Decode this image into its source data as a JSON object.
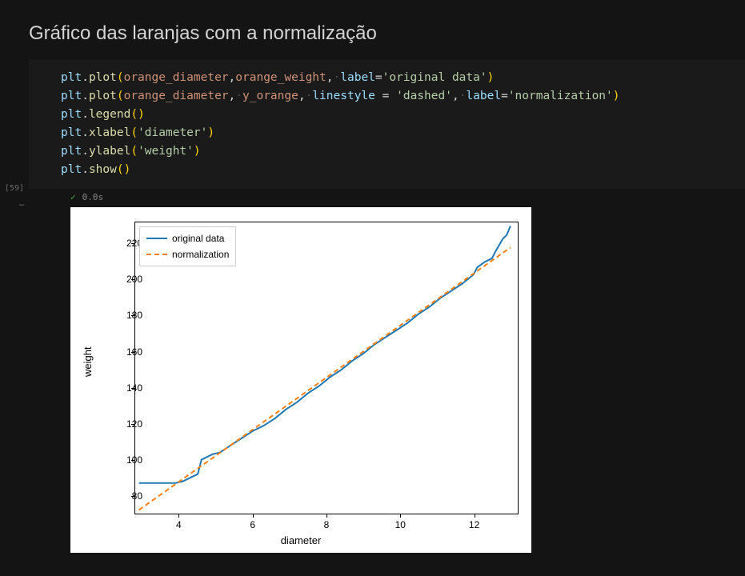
{
  "title": "Gráfico das laranjas com a normalização",
  "code": {
    "l1": {
      "obj": "plt",
      "fn": "plot",
      "arg1": "orange_diameter",
      "arg2": "orange_weight",
      "kw1": "label",
      "str1": "'original data'"
    },
    "l2": {
      "obj": "plt",
      "fn": "plot",
      "arg1": "orange_diameter",
      "arg2": "y_orange",
      "kw1": "linestyle",
      "str1": "'dashed'",
      "kw2": "label",
      "str2": "'normalization'"
    },
    "l3": {
      "obj": "plt",
      "fn": "legend"
    },
    "l4": {
      "obj": "plt",
      "fn": "xlabel",
      "str": "'diameter'"
    },
    "l5": {
      "obj": "plt",
      "fn": "ylabel",
      "str": "'weight'"
    },
    "l6": {
      "obj": "plt",
      "fn": "show"
    }
  },
  "exec": {
    "count": "[59]",
    "time": "0.0s",
    "dots": "…"
  },
  "chart_data": {
    "type": "line",
    "xlabel": "diameter",
    "ylabel": "weight",
    "x_ticks": [
      4,
      6,
      8,
      10,
      12
    ],
    "y_ticks": [
      80,
      100,
      120,
      140,
      160,
      180,
      200,
      220
    ],
    "xlim": [
      2.8,
      13.2
    ],
    "ylim": [
      70,
      232
    ],
    "series": [
      {
        "name": "original data",
        "color": "#1f77b4",
        "style": "solid",
        "x": [
          2.9,
          3.1,
          3.3,
          3.5,
          3.7,
          3.9,
          4.1,
          4.3,
          4.5,
          4.6,
          4.8,
          4.9,
          5.1,
          5.4,
          5.7,
          6.0,
          6.3,
          6.6,
          6.9,
          7.2,
          7.5,
          7.8,
          8.1,
          8.4,
          8.7,
          9.0,
          9.3,
          9.6,
          9.9,
          10.2,
          10.5,
          10.8,
          11.1,
          11.4,
          11.7,
          12.0,
          12.1,
          12.3,
          12.5,
          12.6,
          12.8,
          12.9,
          13.0
        ],
        "y": [
          87,
          87,
          87,
          87,
          87,
          87,
          88,
          90,
          92,
          100,
          102,
          103,
          104,
          108,
          112,
          116,
          119,
          123,
          128,
          132,
          137,
          141,
          146,
          150,
          155,
          159,
          164,
          168,
          172,
          176,
          181,
          185,
          190,
          194,
          198,
          203,
          207,
          210,
          212,
          216,
          223,
          225,
          230
        ]
      },
      {
        "name": "normalization",
        "color": "#ff7f0e",
        "style": "dashed",
        "x": [
          2.9,
          13.0
        ],
        "y": [
          72,
          218
        ]
      }
    ],
    "legend": {
      "entries": [
        "original data",
        "normalization"
      ]
    }
  }
}
